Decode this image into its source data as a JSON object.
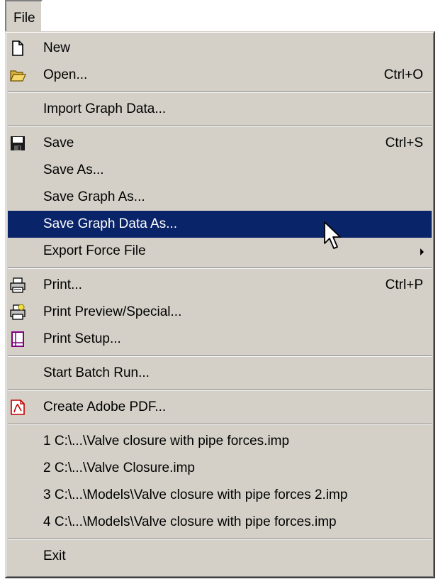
{
  "menubar": {
    "file_label": "File"
  },
  "menu": {
    "items": [
      {
        "label": "New",
        "shortcut": "",
        "icon": "new-document-icon"
      },
      {
        "label": "Open...",
        "shortcut": "Ctrl+O",
        "icon": "open-folder-icon"
      },
      {
        "label": "Import Graph Data...",
        "shortcut": ""
      },
      {
        "label": "Save",
        "shortcut": "Ctrl+S",
        "icon": "floppy-disk-icon"
      },
      {
        "label": "Save As...",
        "shortcut": ""
      },
      {
        "label": "Save Graph As...",
        "shortcut": ""
      },
      {
        "label": "Save Graph Data As...",
        "shortcut": "",
        "highlighted": true
      },
      {
        "label": "Export Force File",
        "shortcut": "",
        "submenu": true
      },
      {
        "label": "Print...",
        "shortcut": "Ctrl+P",
        "icon": "printer-icon"
      },
      {
        "label": "Print Preview/Special...",
        "shortcut": "",
        "icon": "print-preview-icon"
      },
      {
        "label": "Print Setup...",
        "shortcut": "",
        "icon": "print-setup-icon"
      },
      {
        "label": "Start Batch Run...",
        "shortcut": ""
      },
      {
        "label": "Create Adobe PDF...",
        "shortcut": "",
        "icon": "adobe-pdf-icon"
      },
      {
        "label": "1 C:\\...\\Valve closure with pipe forces.imp",
        "shortcut": ""
      },
      {
        "label": "2 C:\\...\\Valve Closure.imp",
        "shortcut": ""
      },
      {
        "label": "3 C:\\...\\Models\\Valve closure with pipe forces 2.imp",
        "shortcut": ""
      },
      {
        "label": "4 C:\\...\\Models\\Valve closure with pipe forces.imp",
        "shortcut": ""
      },
      {
        "label": "Exit",
        "shortcut": ""
      }
    ]
  },
  "colors": {
    "menu_bg": "#d4d0c8",
    "highlight_bg": "#0a246a",
    "highlight_text": "#ffffff"
  }
}
